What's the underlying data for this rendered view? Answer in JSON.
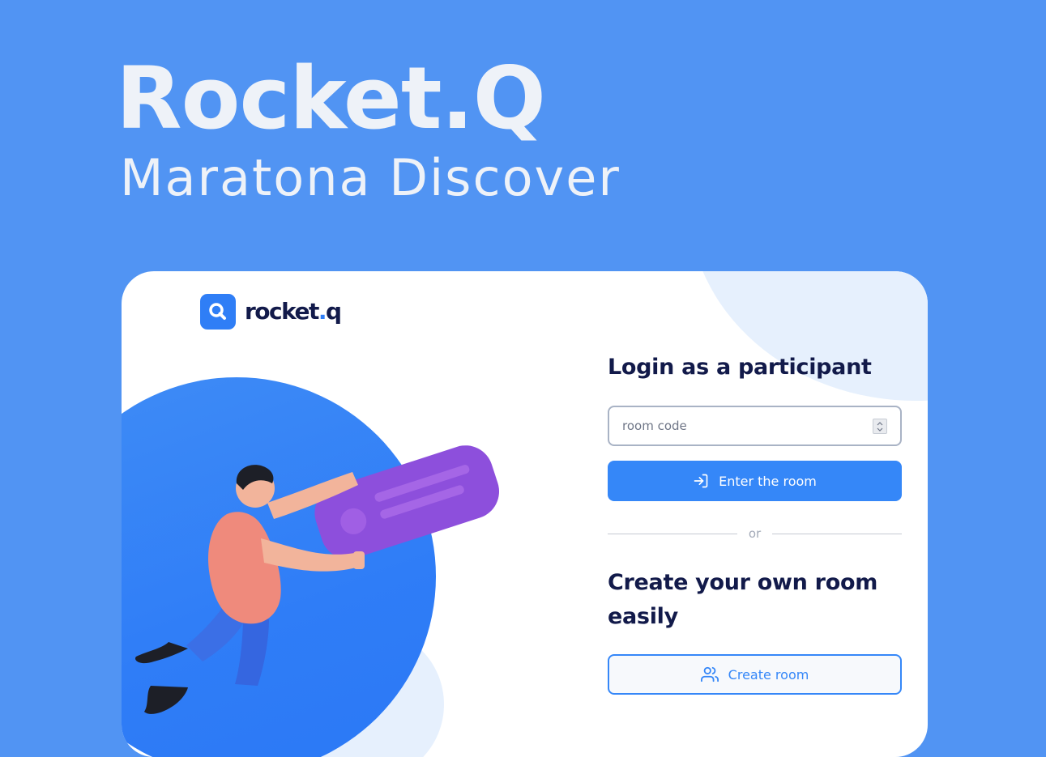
{
  "hero": {
    "title": "Rocket.Q",
    "subtitle": "Maratona Discover"
  },
  "logo": {
    "icon": "rocketq-logo-icon",
    "text_main": "rocket",
    "text_dot": ".",
    "text_end": "q"
  },
  "login": {
    "heading": "Login as a participant",
    "room_input": {
      "placeholder": "room code",
      "value": ""
    },
    "enter_button": {
      "label": "Enter the room",
      "icon": "log-in-icon"
    }
  },
  "divider": {
    "label": "or"
  },
  "create": {
    "heading": "Create your own room easily",
    "button": {
      "label": "Create room",
      "icon": "users-icon"
    }
  },
  "colors": {
    "background": "#5194f3",
    "primary": "#3587f8",
    "heading": "#121a4a",
    "card": "#ffffff"
  }
}
